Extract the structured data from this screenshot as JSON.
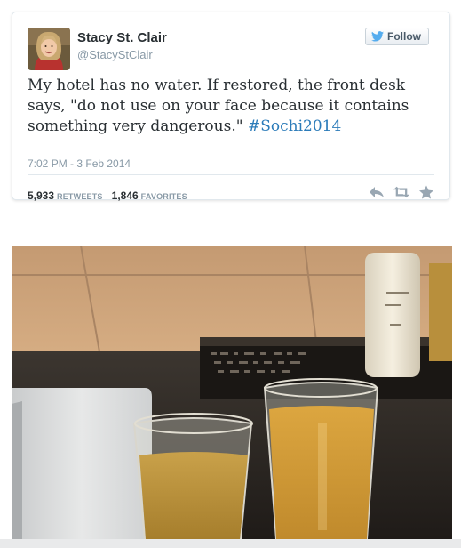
{
  "tweet": {
    "author": {
      "display_name": "Stacy St. Clair",
      "handle": "@StacyStClair"
    },
    "follow_label": "Follow",
    "text_before_hashtag": "My hotel has no water. If restored, the front desk says, \"do not use on your face because it contains something very dangerous.\" ",
    "hashtag": "#Sochi2014",
    "timestamp": "7:02 PM - 3 Feb 2014",
    "stats": {
      "retweets_count": "5,933",
      "retweets_label": "RETWEETS",
      "favorites_count": "1,846",
      "favorites_label": "FAVORITES"
    },
    "actions": [
      "reply-icon",
      "retweet-icon",
      "favorite-icon"
    ]
  },
  "photo": {
    "description_icons": [
      "sink",
      "toiletries-tray",
      "lotion-bottle",
      "glass-of-yellow-water",
      "glass-of-yellow-water"
    ]
  },
  "colors": {
    "link": "#2b7bb9",
    "text": "#292f33",
    "muted": "#8899a6",
    "twitter_blue": "#55acee"
  }
}
